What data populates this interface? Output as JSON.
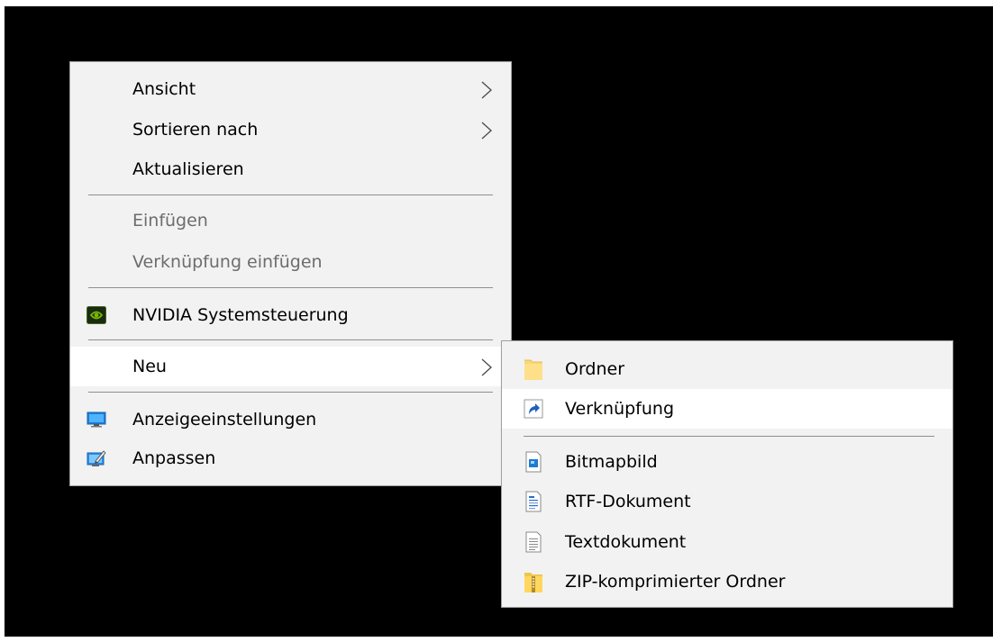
{
  "main_menu": {
    "items": [
      {
        "label": "Ansicht",
        "has_submenu": true,
        "enabled": true
      },
      {
        "label": "Sortieren nach",
        "has_submenu": true,
        "enabled": true
      },
      {
        "label": "Aktualisieren",
        "enabled": true
      },
      {
        "label": "Einfügen",
        "enabled": false
      },
      {
        "label": "Verknüpfung einfügen",
        "enabled": false
      },
      {
        "label": "NVIDIA Systemsteuerung",
        "icon": "nvidia-icon",
        "enabled": true
      },
      {
        "label": "Neu",
        "has_submenu": true,
        "enabled": true,
        "highlighted": true
      },
      {
        "label": "Anzeigeeinstellungen",
        "icon": "display-icon",
        "enabled": true
      },
      {
        "label": "Anpassen",
        "icon": "personalize-icon",
        "enabled": true
      }
    ]
  },
  "sub_menu": {
    "items": [
      {
        "label": "Ordner",
        "icon": "folder-icon"
      },
      {
        "label": "Verknüpfung",
        "icon": "shortcut-icon",
        "highlighted": true
      },
      {
        "label": "Bitmapbild",
        "icon": "bitmap-icon"
      },
      {
        "label": "RTF-Dokument",
        "icon": "rtf-document-icon"
      },
      {
        "label": "Textdokument",
        "icon": "text-document-icon"
      },
      {
        "label": "ZIP-komprimierter Ordner",
        "icon": "zip-folder-icon"
      }
    ]
  },
  "colors": {
    "desktop_background": "#000000",
    "menu_background": "#f2f2f2",
    "highlight": "#ffffff",
    "disabled_text": "#6d6d6d",
    "separator": "#8f8f8f"
  }
}
